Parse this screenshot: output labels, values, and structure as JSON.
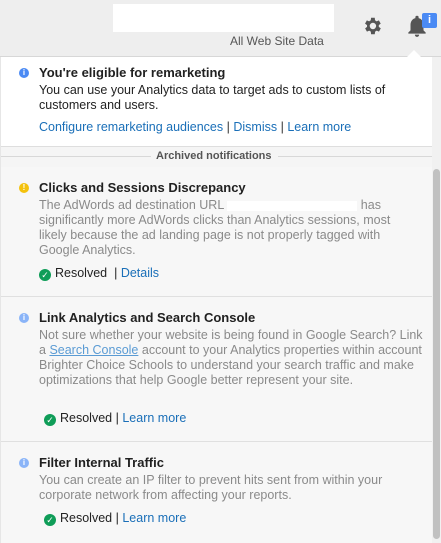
{
  "header": {
    "account_label": "All Web Site Data",
    "badge": "i"
  },
  "notifications": {
    "active": {
      "title": "You're eligible for remarketing",
      "body": "You can use your Analytics data to target ads to custom lists of customers and users.",
      "links": {
        "configure": "Configure remarketing audiences",
        "dismiss": "Dismiss",
        "learn_more": "Learn more",
        "sep": "|"
      }
    },
    "archived_label": "Archived notifications",
    "archived": [
      {
        "title": "Clicks and Sessions Discrepancy",
        "body_before": "The AdWords ad destination URL",
        "body_after": "has significantly more AdWords clicks than Analytics sessions, most likely because the ad landing page is not properly tagged with Google Analytics.",
        "status": "Resolved",
        "sep": "|",
        "link": "Details"
      },
      {
        "title": "Link Analytics and Search Console",
        "body_1": "Not sure whether your website is being found in Google Search? Link a",
        "body_link": "Search Console",
        "body_2": "account to your Analytics properties within account",
        "account": "Brighter Choice Schools",
        "body_3": "to understand your search traffic and make optimizations that help Google better represent your site.",
        "status": "Resolved",
        "sep": "|",
        "link": "Learn more"
      },
      {
        "title": "Filter Internal Traffic",
        "body": "You can create an IP filter to prevent hits sent from within your corporate network from affecting your reports.",
        "status": "Resolved",
        "sep": "|",
        "link": "Learn more"
      }
    ]
  },
  "colors": {
    "info": "#4a8af4",
    "warning": "#f4c20d",
    "archived_info": "#8ab4f8",
    "resolved": "#0f9d58",
    "link": "#1a6fb8"
  }
}
